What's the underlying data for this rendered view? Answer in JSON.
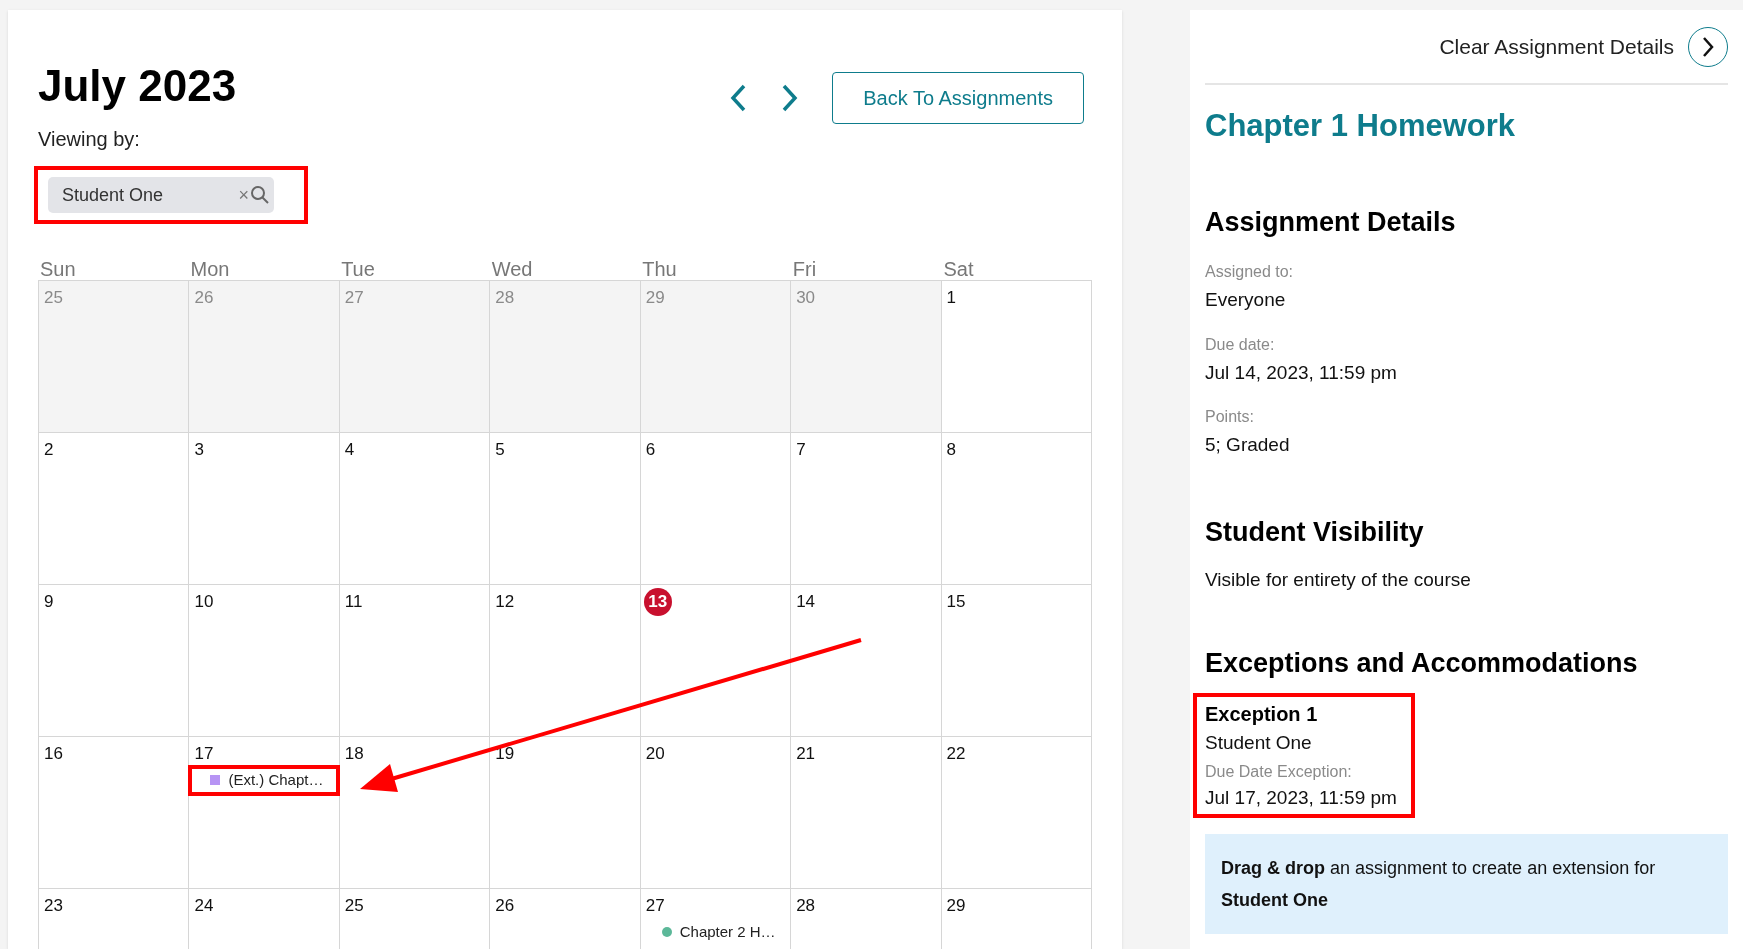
{
  "calendar": {
    "title": "July 2023",
    "back_button": "Back To Assignments",
    "viewing_label": "Viewing by:",
    "viewer": {
      "value": "Student One",
      "clear": "×",
      "highlighted": true
    },
    "weekdays": [
      "Sun",
      "Mon",
      "Tue",
      "Wed",
      "Thu",
      "Fri",
      "Sat"
    ],
    "weeks": [
      [
        {
          "label": "25",
          "outside": true,
          "today": false
        },
        {
          "label": "26",
          "outside": true,
          "today": false
        },
        {
          "label": "27",
          "outside": true,
          "today": false
        },
        {
          "label": "28",
          "outside": true,
          "today": false
        },
        {
          "label": "29",
          "outside": true,
          "today": false
        },
        {
          "label": "30",
          "outside": true,
          "today": false
        },
        {
          "label": "1",
          "outside": false,
          "today": false
        }
      ],
      [
        {
          "label": "2",
          "outside": false,
          "today": false
        },
        {
          "label": "3",
          "outside": false,
          "today": false
        },
        {
          "label": "4",
          "outside": false,
          "today": false
        },
        {
          "label": "5",
          "outside": false,
          "today": false
        },
        {
          "label": "6",
          "outside": false,
          "today": false
        },
        {
          "label": "7",
          "outside": false,
          "today": false
        },
        {
          "label": "8",
          "outside": false,
          "today": false
        }
      ],
      [
        {
          "label": "9",
          "outside": false,
          "today": false
        },
        {
          "label": "10",
          "outside": false,
          "today": false
        },
        {
          "label": "11",
          "outside": false,
          "today": false
        },
        {
          "label": "12",
          "outside": false,
          "today": false
        },
        {
          "label": "13",
          "outside": false,
          "today": true
        },
        {
          "label": "14",
          "outside": false,
          "today": false
        },
        {
          "label": "15",
          "outside": false,
          "today": false
        }
      ],
      [
        {
          "label": "16",
          "outside": false,
          "today": false
        },
        {
          "label": "17",
          "outside": false,
          "today": false,
          "events": [
            {
              "label": "(Ext.) Chapt…",
              "kind": "extension",
              "color": "#b794f4",
              "highlighted": true
            }
          ]
        },
        {
          "label": "18",
          "outside": false,
          "today": false
        },
        {
          "label": "19",
          "outside": false,
          "today": false
        },
        {
          "label": "20",
          "outside": false,
          "today": false
        },
        {
          "label": "21",
          "outside": false,
          "today": false
        },
        {
          "label": "22",
          "outside": false,
          "today": false
        }
      ],
      [
        {
          "label": "23",
          "outside": false,
          "today": false
        },
        {
          "label": "24",
          "outside": false,
          "today": false
        },
        {
          "label": "25",
          "outside": false,
          "today": false
        },
        {
          "label": "26",
          "outside": false,
          "today": false
        },
        {
          "label": "27",
          "outside": false,
          "today": false,
          "events": [
            {
              "label": "Chapter 2 H…",
              "kind": "assignment",
              "color": "#5cb899",
              "highlighted": false
            }
          ]
        },
        {
          "label": "28",
          "outside": false,
          "today": false
        },
        {
          "label": "29",
          "outside": false,
          "today": false
        }
      ]
    ]
  },
  "details": {
    "clear_label": "Clear Assignment Details",
    "assignment_title": "Chapter 1 Homework",
    "sections": [
      {
        "heading": "Assignment Details",
        "fields": [
          {
            "label": "Assigned to:",
            "value": "Everyone"
          },
          {
            "label": "Due date:",
            "value": "Jul 14, 2023, 11:59 pm"
          },
          {
            "label": "Points:",
            "value": "5; Graded"
          }
        ]
      },
      {
        "heading": "Student Visibility",
        "text": "Visible for entirety of the course"
      }
    ],
    "exceptions_heading": "Exceptions and Accommodations",
    "exceptions": [
      {
        "title": "Exception 1",
        "student": "Student One",
        "label": "Due Date Exception:",
        "value": "Jul 17, 2023, 11:59 pm",
        "highlighted": true
      }
    ],
    "hint": "**Drag & drop** an assignment to create an extension for **Student One**"
  }
}
